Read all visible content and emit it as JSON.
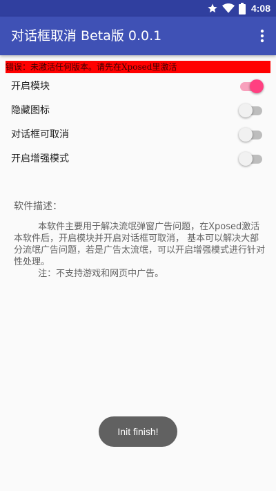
{
  "status_bar": {
    "time": "4:08",
    "icons": [
      "star-icon",
      "wifi-icon",
      "battery-icon"
    ]
  },
  "app_bar": {
    "title": "对话框取消 Beta版 0.0.1",
    "menu_icon": "more-vert-icon"
  },
  "error_banner": {
    "text": "错误：未激活任何版本。请先在Xposed里激活"
  },
  "settings": [
    {
      "label": "开启模块",
      "on": true
    },
    {
      "label": "隐藏图标",
      "on": false
    },
    {
      "label": "对话框可取消",
      "on": false
    },
    {
      "label": "开启增强模式",
      "on": false
    }
  ],
  "description": {
    "title": "软件描述：",
    "paragraph1": "本软件主要用于解决流氓弹窗广告问题，在Xposed激活本软件后，开启模块并开启对话框可取消， 基本可以解决大部分流氓广告问题，若是广告太流氓，可以开启增强模式进行针对性处理。",
    "paragraph2": "注：不支持游戏和网页中广告。"
  },
  "toast": {
    "text": "Init finish!"
  },
  "colors": {
    "status_bar": "#303f9f",
    "app_bar": "#3f51b5",
    "accent": "#ff4081",
    "error": "#ff0000"
  }
}
